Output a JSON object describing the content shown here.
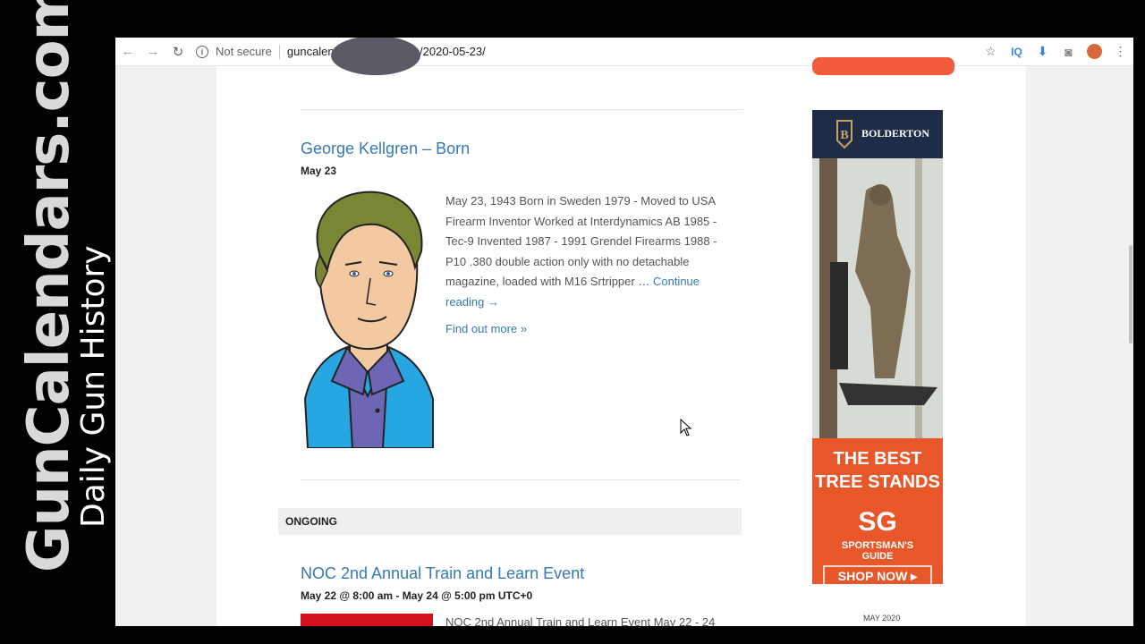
{
  "watermark": {
    "site": "GunCalendars.com",
    "tagline": "Daily Gun History"
  },
  "browser": {
    "security_label": "Not secure",
    "url": "guncalendars.com/events/2020-05-23/",
    "icons": [
      "back-arrow-icon",
      "forward-arrow-icon",
      "reload-icon",
      "info-icon",
      "star-icon",
      "iq-extension-icon",
      "download-extension-icon",
      "camera-extension-icon",
      "profile-avatar-icon",
      "menu-dots-icon"
    ]
  },
  "event": {
    "title": "George Kellgren – Born",
    "date": "May 23",
    "description": "May 23, 1943 Born in Sweden 1979 - Moved to USA Firearm Inventor Worked at Interdynamics AB 1985 - Tec-9 Invented 1987 - 1991 Grendel Firearms 1988 - P10 .380 double action only with no detachable magazine, loaded with M16 Srtripper …",
    "continue_label": "Continue reading →",
    "find_more_label": "Find out more »"
  },
  "ongoing": {
    "header": "ONGOING",
    "title": "NOC 2nd Annual Train and Learn Event",
    "date": "May 22 @ 8:00 am - May 24 @ 5:00 pm UTC+0",
    "description": "NOC 2nd Annual Train and Learn Event May 22 - 24"
  },
  "ad": {
    "brand": "BOLDERTON",
    "headline_1": "THE BEST",
    "headline_2": "TREE STANDS",
    "sponsor_1": "SPORTSMAN'S",
    "sponsor_2": "GUIDE",
    "cta": "SHOP NOW ▸",
    "colors": {
      "header": "#1e2c48",
      "body": "#e8572a",
      "gold": "#c8a45a"
    }
  },
  "calendar": {
    "month": "MAY 2020"
  }
}
